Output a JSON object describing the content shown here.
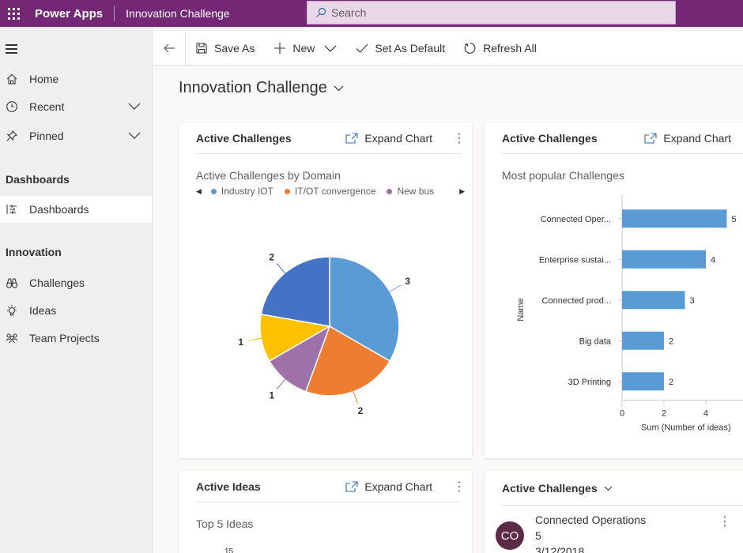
{
  "topbar": {
    "app_name": "Power Apps",
    "page_name": "Innovation Challenge",
    "search_placeholder": "Search"
  },
  "sidebar": {
    "items": [
      {
        "label": "Home",
        "icon": "home-icon"
      },
      {
        "label": "Recent",
        "icon": "clock-icon"
      },
      {
        "label": "Pinned",
        "icon": "pin-icon"
      }
    ],
    "section_dashboards": "Dashboards",
    "dashboards_item": "Dashboards",
    "section_innovation": "Innovation",
    "innovation_items": [
      {
        "label": "Challenges",
        "icon": "binoculars-icon"
      },
      {
        "label": "Ideas",
        "icon": "lightbulb-icon"
      },
      {
        "label": "Team Projects",
        "icon": "team-icon"
      }
    ]
  },
  "commandbar": {
    "save_as": "Save As",
    "new": "New",
    "set_default": "Set As Default",
    "refresh_all": "Refresh All"
  },
  "dashboard_title": "Innovation Challenge",
  "cards": {
    "pie_card": {
      "title": "Active Challenges",
      "expand": "Expand Chart",
      "subtitle": "Active Challenges by Domain"
    },
    "bar_card": {
      "title": "Active Challenges",
      "expand": "Expand Chart",
      "subtitle": "Most popular Challenges"
    },
    "ideas_card": {
      "title": "Active Ideas",
      "expand": "Expand Chart",
      "subtitle": "Top 5 Ideas",
      "axis_peek": "15"
    },
    "list_card": {
      "title": "Active Challenges",
      "avatar": "CO",
      "record_name": "Connected Operations",
      "record_value": "5",
      "record_date": "3/12/2018"
    }
  },
  "chart_data": [
    {
      "type": "pie",
      "title": "Active Challenges by Domain",
      "legend": [
        "Industry IOT",
        "IT/OT convergence",
        "New bus"
      ],
      "slices": [
        {
          "name": "Industry IOT",
          "value": 3,
          "color": "#5b9bd5"
        },
        {
          "name": "IT/OT convergence",
          "value": 2,
          "color": "#ed7d31"
        },
        {
          "name": "New bus",
          "value": 1,
          "color": "#9e72a8"
        },
        {
          "name": "",
          "value": 1,
          "color": "#ffc000"
        },
        {
          "name": "",
          "value": 2,
          "color": "#4472c4"
        }
      ]
    },
    {
      "type": "bar",
      "orientation": "horizontal",
      "title": "Most popular Challenges",
      "categories": [
        "Connected Oper...",
        "Enterprise sustai...",
        "Connected prod...",
        "Big data",
        "3D Printing"
      ],
      "values": [
        5,
        4,
        3,
        2,
        2
      ],
      "xlabel": "Sum (Number of ideas)",
      "ylabel": "Name",
      "xticks": [
        0,
        2,
        4
      ],
      "xlim": [
        0,
        5.6
      ],
      "color": "#5b9bd5"
    }
  ]
}
